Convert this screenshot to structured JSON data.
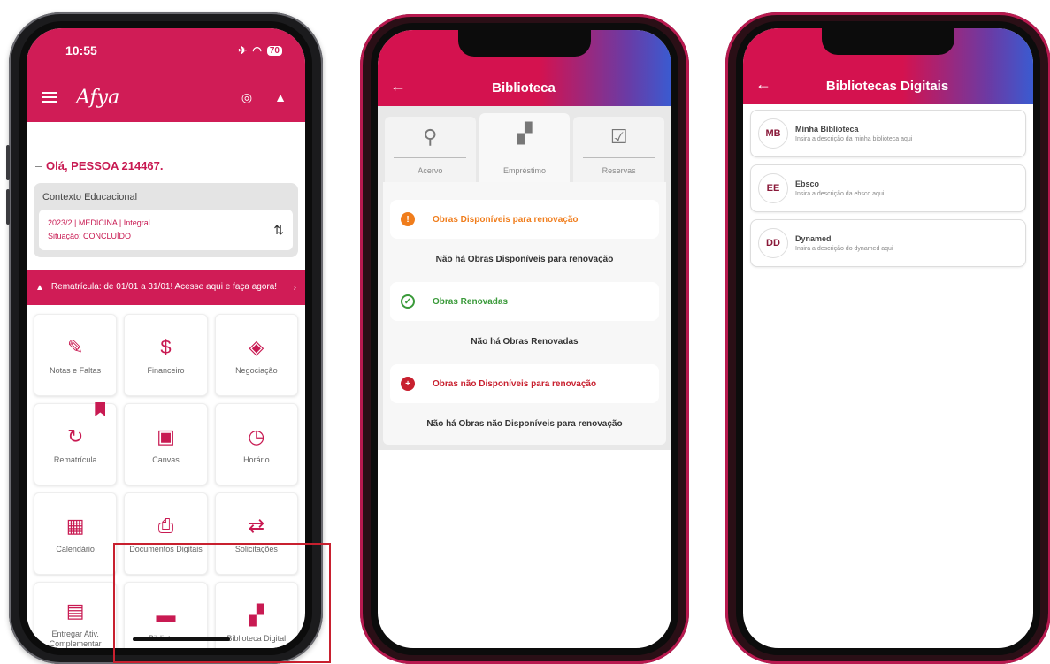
{
  "phone1": {
    "status": {
      "time": "10:55",
      "airplane": "✈",
      "wifi": "◠",
      "battery": "70"
    },
    "appbar": {
      "brand": "Afya"
    },
    "greeting": "Olá, PESSOA 214467.",
    "context": {
      "title": "Contexto Educacional",
      "line1": "2023/2 | MEDICINA | Integral",
      "line2": "Situação: CONCLUÍDO"
    },
    "banner": "Rematrícula: de 01/01 a 31/01! Acesse aqui e faça agora!",
    "tiles": [
      {
        "label": "Notas e Faltas",
        "icon": "pencil-icon",
        "glyph": "✎"
      },
      {
        "label": "Financeiro",
        "icon": "dollar-icon",
        "glyph": "$"
      },
      {
        "label": "Negociação",
        "icon": "handshake-icon",
        "glyph": "◈"
      },
      {
        "label": "Rematrícula",
        "icon": "refresh-icon",
        "glyph": "↻"
      },
      {
        "label": "Canvas",
        "icon": "canvas-icon",
        "glyph": "▣"
      },
      {
        "label": "Horário",
        "icon": "clock-icon",
        "glyph": "◷"
      },
      {
        "label": "Calendário",
        "icon": "calendar-icon",
        "glyph": "▦"
      },
      {
        "label": "Documentos Digitais",
        "icon": "printer-icon",
        "glyph": "⎙"
      },
      {
        "label": "Solicitações",
        "icon": "swap-icon",
        "glyph": "⇄"
      },
      {
        "label": "Entregar Ativ. Complementar",
        "icon": "file-add-icon",
        "glyph": "▤"
      },
      {
        "label": "Biblioteca",
        "icon": "book-icon",
        "glyph": "▬"
      },
      {
        "label": "Biblioteca Digital",
        "icon": "reader-icon",
        "glyph": "▞"
      }
    ]
  },
  "phone2": {
    "title": "Biblioteca",
    "tabs": [
      {
        "label": "Acervo",
        "glyph": "⚲"
      },
      {
        "label": "Empréstimo",
        "glyph": "▞"
      },
      {
        "label": "Reservas",
        "glyph": "☑"
      }
    ],
    "sections": [
      {
        "label": "Obras Disponíveis para renovação",
        "empty": "Não há Obras Disponíveis para renovação",
        "color": "#f07d1c",
        "glyph": "!"
      },
      {
        "label": "Obras Renovadas",
        "empty": "Não há Obras Renovadas",
        "color": "#3a9a3a",
        "glyph": "✓"
      },
      {
        "label": "Obras não Disponíveis para renovação",
        "empty": "Não há Obras não Disponíveis para renovação",
        "color": "#c8202f",
        "glyph": "+"
      }
    ]
  },
  "phone3": {
    "title": "Bibliotecas Digitais",
    "libraries": [
      {
        "initials": "MB",
        "name": "Minha Biblioteca",
        "desc": "Insira a descrição da minha biblioteca aqui"
      },
      {
        "initials": "EE",
        "name": "Ebsco",
        "desc": "Insira a descrição da ebsco aqui"
      },
      {
        "initials": "DD",
        "name": "Dynamed",
        "desc": "Insira a descrição do dynamed aqui"
      }
    ]
  },
  "colors": {
    "brand": "#d01c56",
    "highlight_box": "#c8202f"
  }
}
